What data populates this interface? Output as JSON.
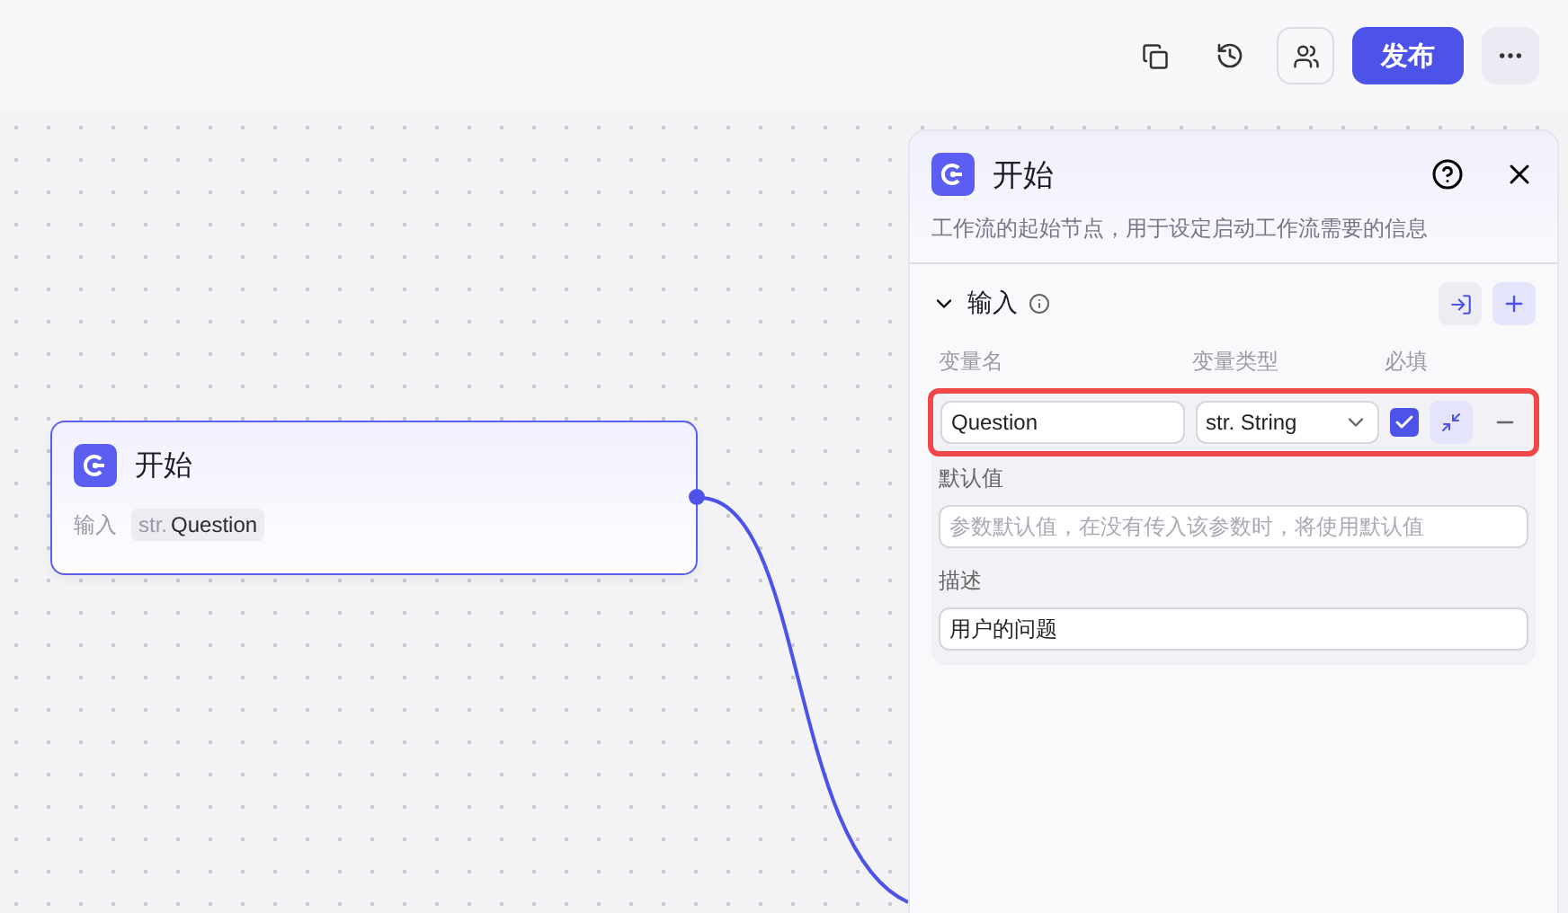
{
  "toolbar": {
    "publish": "发布"
  },
  "node": {
    "title": "开始",
    "input_label": "输入",
    "param_type": "str.",
    "param_name": "Question",
    "selected": true
  },
  "panel": {
    "title": "开始",
    "description": "工作流的起始节点，用于设定启动工作流需要的信息",
    "section": {
      "title": "输入",
      "expanded": true
    },
    "columns": [
      "变量名",
      "变量类型",
      "必填"
    ],
    "variables": [
      {
        "name": "Question",
        "type": "str. String",
        "required": true,
        "highlighted": true,
        "default_label": "默认值",
        "default_placeholder": "参数默认值，在没有传入该参数时，将使用默认值",
        "desc_label": "描述",
        "desc_value": "用户的问题"
      }
    ]
  }
}
